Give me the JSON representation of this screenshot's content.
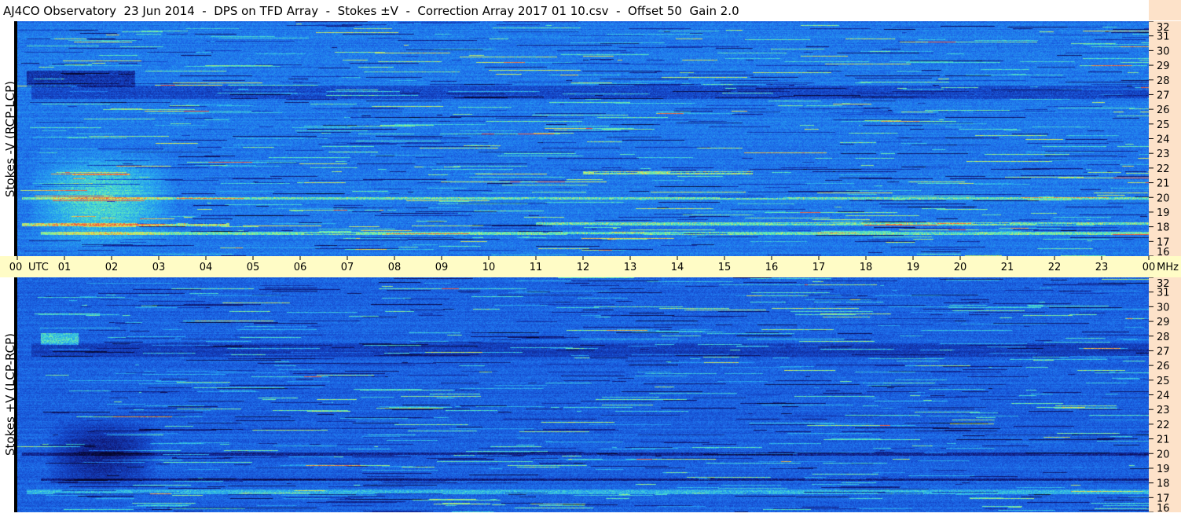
{
  "title": "AJ4CO Observatory  23 Jun 2014  -  DPS on TFD Array  -  Stokes ±V  -  Correction Array 2017 01 10.csv  -  Offset 50  Gain 2.0",
  "colors": {
    "background": "#1a5ee6",
    "axis_time_bg": "#fffcc6",
    "axis_freq_bg": "#fde2c9"
  },
  "chart_data": [
    {
      "type": "heatmap",
      "title": "",
      "ylabel": "Stokes -V (RCP-LCP)",
      "x_ticks": [
        "00",
        "01",
        "02",
        "03",
        "04",
        "05",
        "06",
        "07",
        "08",
        "09",
        "10",
        "11",
        "12",
        "13",
        "14",
        "15",
        "16",
        "17",
        "18",
        "19",
        "20",
        "21",
        "22",
        "23",
        "00"
      ],
      "x_unit": "UTC",
      "xlim": [
        0,
        24
      ],
      "y_unit": "MHz",
      "ylim": [
        16,
        32
      ],
      "y_ticks": [
        32,
        31,
        30,
        29,
        28,
        27,
        26,
        25,
        24,
        23,
        22,
        21,
        20,
        19,
        18,
        17,
        16
      ],
      "features": [
        {
          "name": "emission-cloud",
          "t": [
            0.2,
            3.4
          ],
          "f": [
            16.2,
            23.5
          ],
          "level": 0.45
        },
        {
          "name": "line-20mhz",
          "t": [
            0.1,
            24
          ],
          "f": [
            19.95,
            20.0
          ],
          "level": 0.55
        },
        {
          "name": "line-18mhz",
          "t": [
            0.1,
            4.5
          ],
          "f": [
            18.1,
            18.2
          ],
          "level": 0.75
        },
        {
          "name": "line-18mhz-late",
          "t": [
            11,
            24
          ],
          "f": [
            18.15,
            18.25
          ],
          "level": 0.6
        },
        {
          "name": "line-17-6mhz",
          "t": [
            0.5,
            24
          ],
          "f": [
            17.55,
            17.65
          ],
          "level": 0.55
        },
        {
          "name": "line-21-7mhz",
          "t": [
            12,
            15.6
          ],
          "f": [
            21.65,
            21.75
          ],
          "level": 0.7
        },
        {
          "name": "band-27mhz-dark",
          "t": [
            0.3,
            24
          ],
          "f": [
            26.8,
            27.6
          ],
          "level": -0.3
        },
        {
          "name": "band-28mhz-dark",
          "t": [
            0.2,
            2.5
          ],
          "f": [
            27.6,
            28.6
          ],
          "level": -0.45
        }
      ]
    },
    {
      "type": "heatmap",
      "title": "",
      "ylabel": "Stokes +V (LCP-RCP)",
      "x_ticks": [
        "00",
        "01",
        "02",
        "03",
        "04",
        "05",
        "06",
        "07",
        "08",
        "09",
        "10",
        "11",
        "12",
        "13",
        "14",
        "15",
        "16",
        "17",
        "18",
        "19",
        "20",
        "21",
        "22",
        "23",
        "00"
      ],
      "x_unit": "UTC",
      "xlim": [
        0,
        24
      ],
      "y_unit": "MHz",
      "ylim": [
        16,
        32
      ],
      "y_ticks": [
        32,
        31,
        30,
        29,
        28,
        27,
        26,
        25,
        24,
        23,
        22,
        21,
        20,
        19,
        18,
        17,
        16
      ],
      "features": [
        {
          "name": "absorption-cloud",
          "t": [
            0.6,
            3.0
          ],
          "f": [
            17.5,
            22.5
          ],
          "level": -0.5
        },
        {
          "name": "line-20mhz-dark",
          "t": [
            0.1,
            24
          ],
          "f": [
            19.95,
            20.05
          ],
          "level": -0.5
        },
        {
          "name": "line-18mhz-dark",
          "t": [
            0.5,
            24
          ],
          "f": [
            18.2,
            18.3
          ],
          "level": -0.55
        },
        {
          "name": "line-17-5mhz",
          "t": [
            0.2,
            24
          ],
          "f": [
            17.3,
            17.5
          ],
          "level": 0.4
        },
        {
          "name": "band-27mhz",
          "t": [
            0.3,
            24
          ],
          "f": [
            26.7,
            27.5
          ],
          "level": -0.25
        },
        {
          "name": "patch-28mhz",
          "t": [
            0.5,
            1.3
          ],
          "f": [
            27.5,
            28.2
          ],
          "level": 0.55
        }
      ]
    }
  ]
}
